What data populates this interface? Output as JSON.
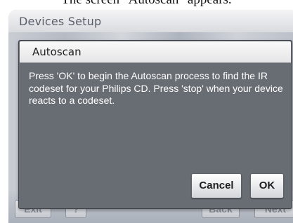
{
  "caption": "The screen \"Autoscan\" appears.",
  "screen": {
    "title": "Devices Setup"
  },
  "dialog": {
    "title": "Autoscan",
    "message": "Press 'OK' to begin the Autoscan process to find the IR codeset for your Philips CD. Press 'stop' when your device reacts to a codeset.",
    "cancel_label": "Cancel",
    "ok_label": "OK"
  },
  "footer": {
    "exit_label": "Exit",
    "help_label": "?",
    "back_label": "Back",
    "next_label": "Next"
  }
}
